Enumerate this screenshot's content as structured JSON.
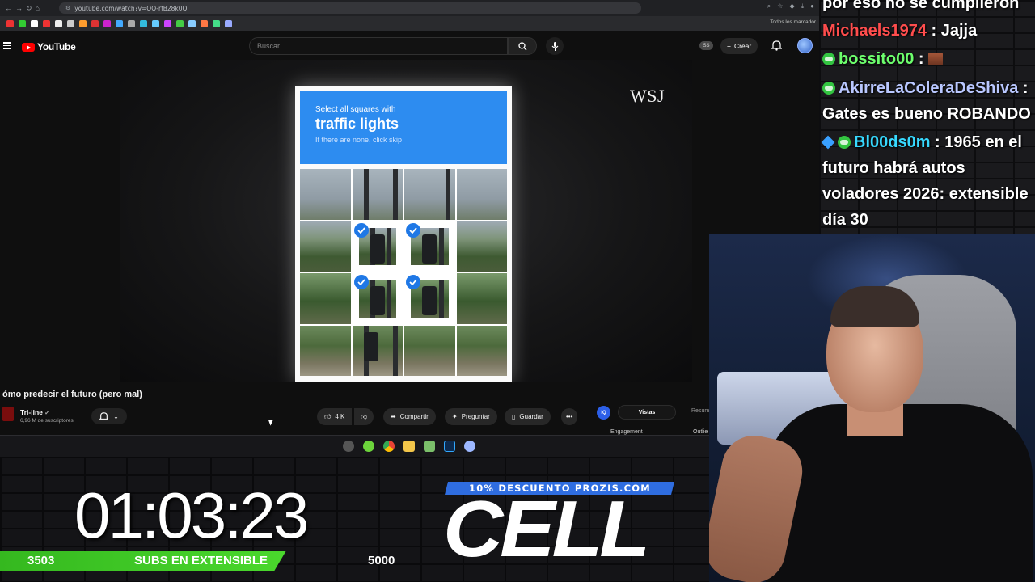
{
  "browser": {
    "url": "youtube.com/watch?v=OQ-rfB28k0Q",
    "bookmarks_all_label": "Todos los marcador"
  },
  "youtube": {
    "logo_text": "YouTube",
    "search_placeholder": "Buscar",
    "ss_badge": "SS",
    "create_label": "Crear"
  },
  "video": {
    "watermark": "WSJ",
    "captcha": {
      "line1": "Select all squares with",
      "target": "traffic lights",
      "hint": "If there are none, click skip",
      "selected_tiles": [
        5,
        6,
        9,
        10
      ]
    },
    "title": "ómo predecir el futuro (pero mal)",
    "channel_name": "Tri-line",
    "channel_subs": "6,96 M de suscriptores",
    "likes": "4 K",
    "share_label": "Compartir",
    "ask_label": "Preguntar",
    "save_label": "Guardar"
  },
  "side_panel": {
    "iq_label": "IQ",
    "tab_active": "Vistas",
    "tab_other": "Resum",
    "col1": "Engagement",
    "col2": "Outlie"
  },
  "overlay": {
    "timer": "01:03:23",
    "subs_current": "3503",
    "subs_label": "SUBS EN EXTENSIBLE",
    "subs_goal": "5000",
    "subs_progress": 0.7,
    "promo": "10% DESCUENTO PROZIS.COM",
    "sponsor": "CELL"
  },
  "chat": [
    {
      "user": "",
      "text": "por eso no se cumplieron",
      "user_color": "#ffffff"
    },
    {
      "user": "Michaels1974",
      "text": " : Jajja",
      "user_color": "#ff4d4d"
    },
    {
      "user": "bossito00",
      "text": " : ",
      "user_color": "#6dff6d",
      "emote": true
    },
    {
      "user": "AkirreLaColeraDeShiva",
      "text": " :",
      "user_color": "#b9c7ff"
    },
    {
      "user": "",
      "text": "Gates es bueno ROBANDO",
      "user_color": "#ffffff"
    },
    {
      "user": "Bl00ds0m",
      "text": " : 1965 en el",
      "user_color": "#37d9ff"
    },
    {
      "user": "",
      "text": "futuro habrá autos",
      "user_color": "#ffffff"
    },
    {
      "user": "",
      "text": "voladores 2026: extensible",
      "user_color": "#ffffff"
    },
    {
      "user": "",
      "text": "día 30",
      "user_color": "#ffffff"
    }
  ]
}
